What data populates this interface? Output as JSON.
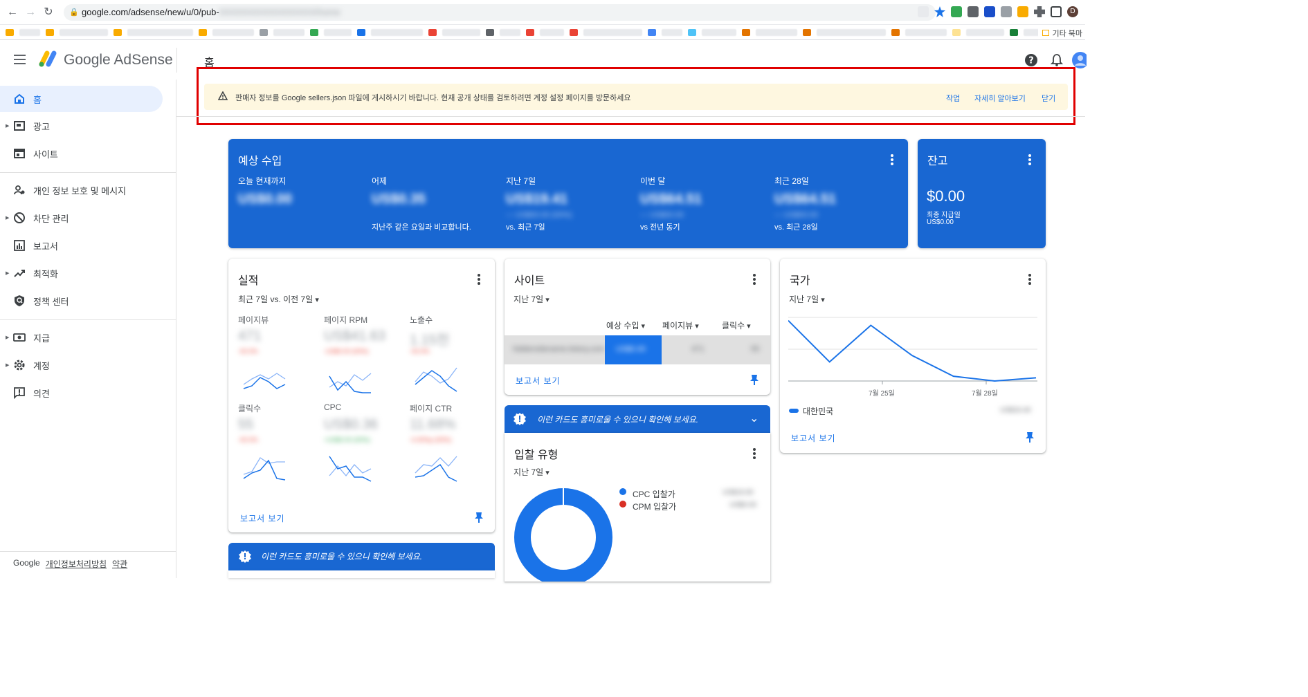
{
  "browser": {
    "url_prefix": "google.com/adsense/new/u/0/pub-",
    "url_hidden": "XXXXXXXXXXXXXXXX/home",
    "other_bookmarks": "기타 북마",
    "profile_initial": "D"
  },
  "header": {
    "brand": "Google AdSense",
    "page_title": "홈"
  },
  "sidebar": {
    "items": [
      {
        "label": "홈",
        "icon": "home-icon",
        "active": true
      },
      {
        "label": "광고",
        "icon": "ads-icon"
      },
      {
        "label": "사이트",
        "icon": "sites-icon"
      },
      {
        "label": "개인 정보 보호 및 메시지",
        "icon": "privacy-icon"
      },
      {
        "label": "차단 관리",
        "icon": "block-icon"
      },
      {
        "label": "보고서",
        "icon": "reports-icon"
      },
      {
        "label": "최적화",
        "icon": "optimize-icon"
      },
      {
        "label": "정책 센터",
        "icon": "policy-icon"
      },
      {
        "label": "지급",
        "icon": "payments-icon"
      },
      {
        "label": "계정",
        "icon": "settings-icon"
      },
      {
        "label": "의견",
        "icon": "feedback-icon"
      }
    ],
    "footer": {
      "brand": "Google",
      "privacy": "개인정보처리방침",
      "terms": "약관"
    }
  },
  "banner": {
    "message": "판매자 정보를 Google sellers.json 파일에 게시하시기 바랍니다. 현재 공개 상태를 검토하려면 계정 설정 페이지를 방문하세요",
    "action": "작업",
    "learn_more": "자세히 알아보기",
    "close": "닫기"
  },
  "earnings": {
    "title": "예상 수입",
    "columns": [
      {
        "label": "오늘 현재까지",
        "value": "US$0.00",
        "compare_value": "",
        "sub": ""
      },
      {
        "label": "어제",
        "value": "US$0.35",
        "compare_value": "",
        "sub": "지난주 같은 요일과 비교합니다."
      },
      {
        "label": "지난 7일",
        "value": "US$19.41",
        "compare_value": "— US$00.00 (00%)",
        "sub": "vs. 최근 7일"
      },
      {
        "label": "이번 달",
        "value": "US$64.51",
        "compare_value": "— US$00.00",
        "sub": "vs 전년 동기"
      },
      {
        "label": "최근 28일",
        "value": "US$64.51",
        "compare_value": "— US$00.00",
        "sub": "vs. 최근 28일"
      }
    ]
  },
  "balance": {
    "title": "잔고",
    "amount": "$0.00",
    "last_payment_label": "최종 지급일",
    "last_payment_value": "US$0.00"
  },
  "performance": {
    "title": "실적",
    "range": "최근 7일 vs. 이전 7일",
    "metrics": [
      {
        "label": "페이지뷰",
        "value": "471",
        "delta": "-00.0%",
        "delta_color": "#ea4335"
      },
      {
        "label": "페이지 RPM",
        "value": "US$41.63",
        "delta": "-US$0.00 (00%)",
        "delta_color": "#ea4335"
      },
      {
        "label": "노출수",
        "value": "1.15천",
        "delta": "-00.0%",
        "delta_color": "#ea4335"
      },
      {
        "label": "클릭수",
        "value": "55",
        "delta": "-00.0%",
        "delta_color": "#ea4335"
      },
      {
        "label": "CPC",
        "value": "US$0.36",
        "delta": "+US$0.00 (00%)",
        "delta_color": "#34a853"
      },
      {
        "label": "페이지 CTR",
        "value": "11.68%",
        "delta": "-0.00%p (00%)",
        "delta_color": "#ea4335"
      }
    ],
    "report_link": "보고서 보기"
  },
  "sites": {
    "title": "사이트",
    "range": "지난 7일",
    "columns": [
      "예상 수입",
      "페이지뷰",
      "클릭수"
    ],
    "rows": [
      {
        "site": "hiddensitename.tistory.com",
        "earnings": "US$0.00",
        "pageviews": "471",
        "clicks": "55"
      }
    ],
    "report_link": "보고서 보기"
  },
  "tip": {
    "text": "이런 카드도 흥미로울 수 있으니 확인해 보세요."
  },
  "bids": {
    "title": "입찰 유형",
    "range": "지난 7일",
    "legend": [
      {
        "label": "CPC 입찰가",
        "color": "#1a73e8",
        "value": "US$19.00",
        "share": 1.0
      },
      {
        "label": "CPM 입찰가",
        "color": "#d93025",
        "value": "US$0.00",
        "share": 0.0
      }
    ]
  },
  "country": {
    "title": "국가",
    "range": "지난 7일",
    "x_labels": [
      "7월 25일",
      "7월 28일"
    ],
    "series": [
      {
        "name": "대한민국",
        "color": "#1a73e8",
        "value": "US$19.40",
        "points": [
          {
            "x": 0,
            "y": 3.8
          },
          {
            "x": 1,
            "y": 1.2
          },
          {
            "x": 2,
            "y": 3.5
          },
          {
            "x": 3,
            "y": 1.6
          },
          {
            "x": 4,
            "y": 0.3
          },
          {
            "x": 5,
            "y": 0.0
          },
          {
            "x": 6,
            "y": 0.2
          }
        ]
      }
    ],
    "report_link": "보고서 보기"
  },
  "colors": {
    "brand_blue": "#1967d2",
    "link_blue": "#1a73e8",
    "banner_bg": "#fef7e0",
    "highlight_red": "#e00000"
  }
}
